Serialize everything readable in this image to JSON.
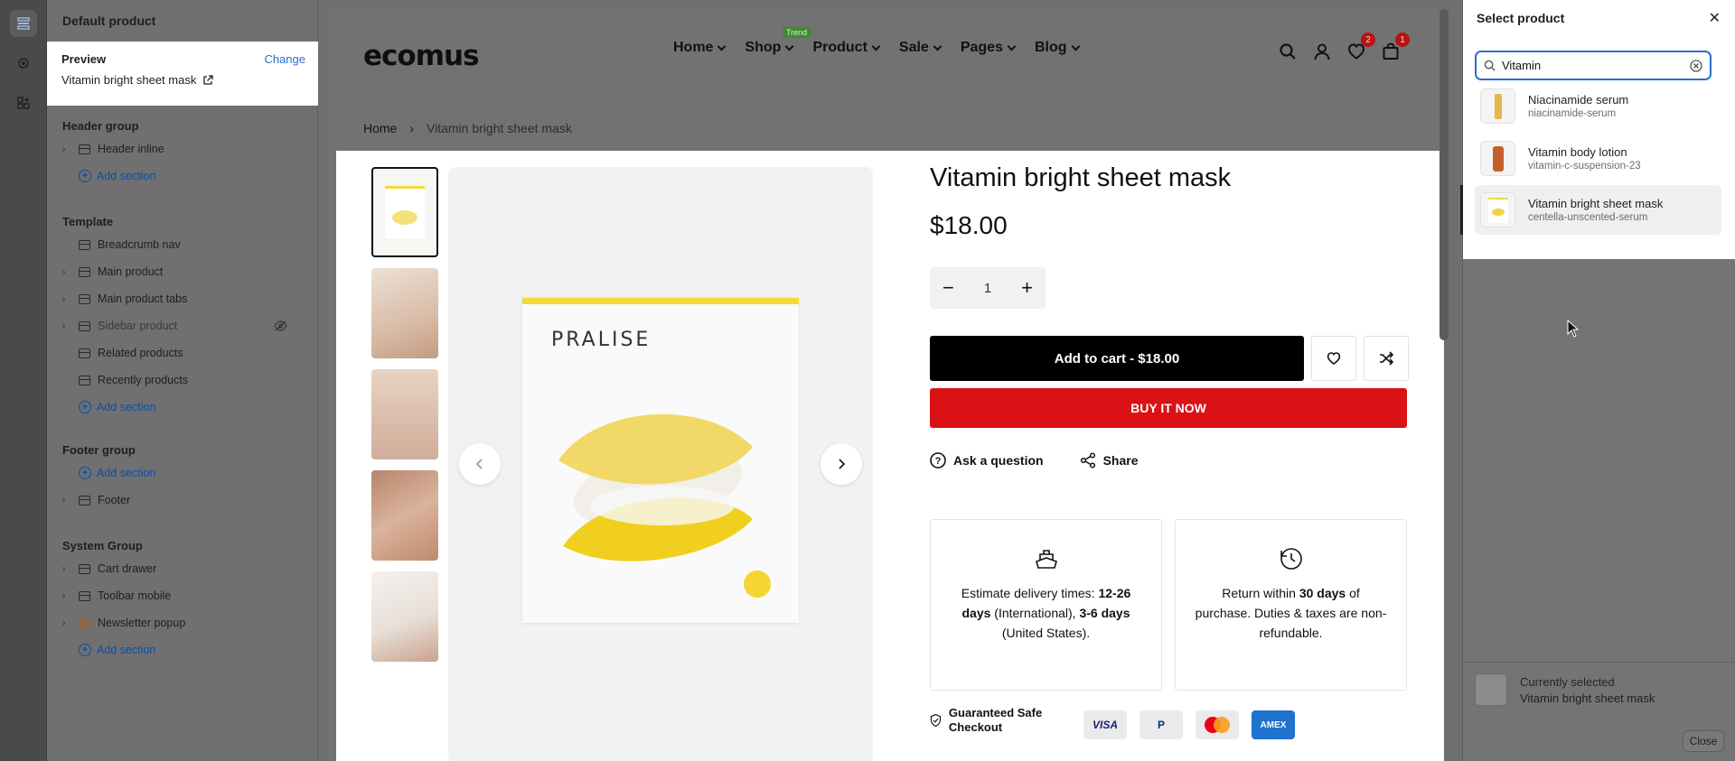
{
  "sidebar": {
    "title": "Default product",
    "preview": {
      "label": "Preview",
      "change": "Change",
      "value": "Vitamin bright sheet mask"
    },
    "header_group": {
      "title": "Header group",
      "items": [
        "Header inline"
      ],
      "add": "Add section"
    },
    "template": {
      "title": "Template",
      "items": [
        "Breadcrumb nav",
        "Main product",
        "Main product tabs",
        "Sidebar product",
        "Related products",
        "Recently products"
      ],
      "add": "Add section"
    },
    "footer_group": {
      "title": "Footer group",
      "add": "Add section",
      "items": [
        "Footer"
      ]
    },
    "system_group": {
      "title": "System Group",
      "items": [
        "Cart drawer",
        "Toolbar mobile",
        "Newsletter popup"
      ],
      "add": "Add section"
    }
  },
  "store": {
    "logo": "ecomus",
    "nav": [
      "Home",
      "Shop",
      "Product",
      "Sale",
      "Pages",
      "Blog"
    ],
    "trend_badge": "Trend",
    "wishlist_count": "2",
    "cart_count": "1",
    "breadcrumb": {
      "home": "Home",
      "current": "Vitamin bright sheet mask"
    }
  },
  "product": {
    "title": "Vitamin bright sheet mask",
    "price": "$18.00",
    "qty": "1",
    "add_to_cart": "Add to cart - $18.00",
    "buy_now": "BUY IT NOW",
    "ask": "Ask a question",
    "share": "Share",
    "pack_brand": "PRALISE",
    "delivery": {
      "p1": "Estimate delivery times: ",
      "b1": "12-26 days",
      "p2": " (International), ",
      "b2": "3-6 days",
      "p3": " (United States)."
    },
    "returns": {
      "p1": "Return within ",
      "b1": "30 days",
      "p2": " of purchase. Duties & taxes are non-refundable."
    },
    "safe_checkout": "Guaranteed Safe Checkout",
    "payments": [
      "VISA",
      "P",
      "MC",
      "AMEX"
    ]
  },
  "picker": {
    "title": "Select product",
    "search_value": "Vitamin",
    "results": [
      {
        "name": "Niacinamide serum",
        "handle": "niacinamide-serum"
      },
      {
        "name": "Vitamin body lotion",
        "handle": "vitamin-c-suspension-23"
      },
      {
        "name": "Vitamin bright sheet mask",
        "handle": "centella-unscented-serum"
      }
    ],
    "currently_label": "Currently selected",
    "currently_value": "Vitamin bright sheet mask",
    "close": "Close"
  },
  "colors": {
    "accent": "#2c6ecb",
    "buy": "#db1215",
    "cart": "#000000",
    "trend": "#3e8b2f"
  }
}
